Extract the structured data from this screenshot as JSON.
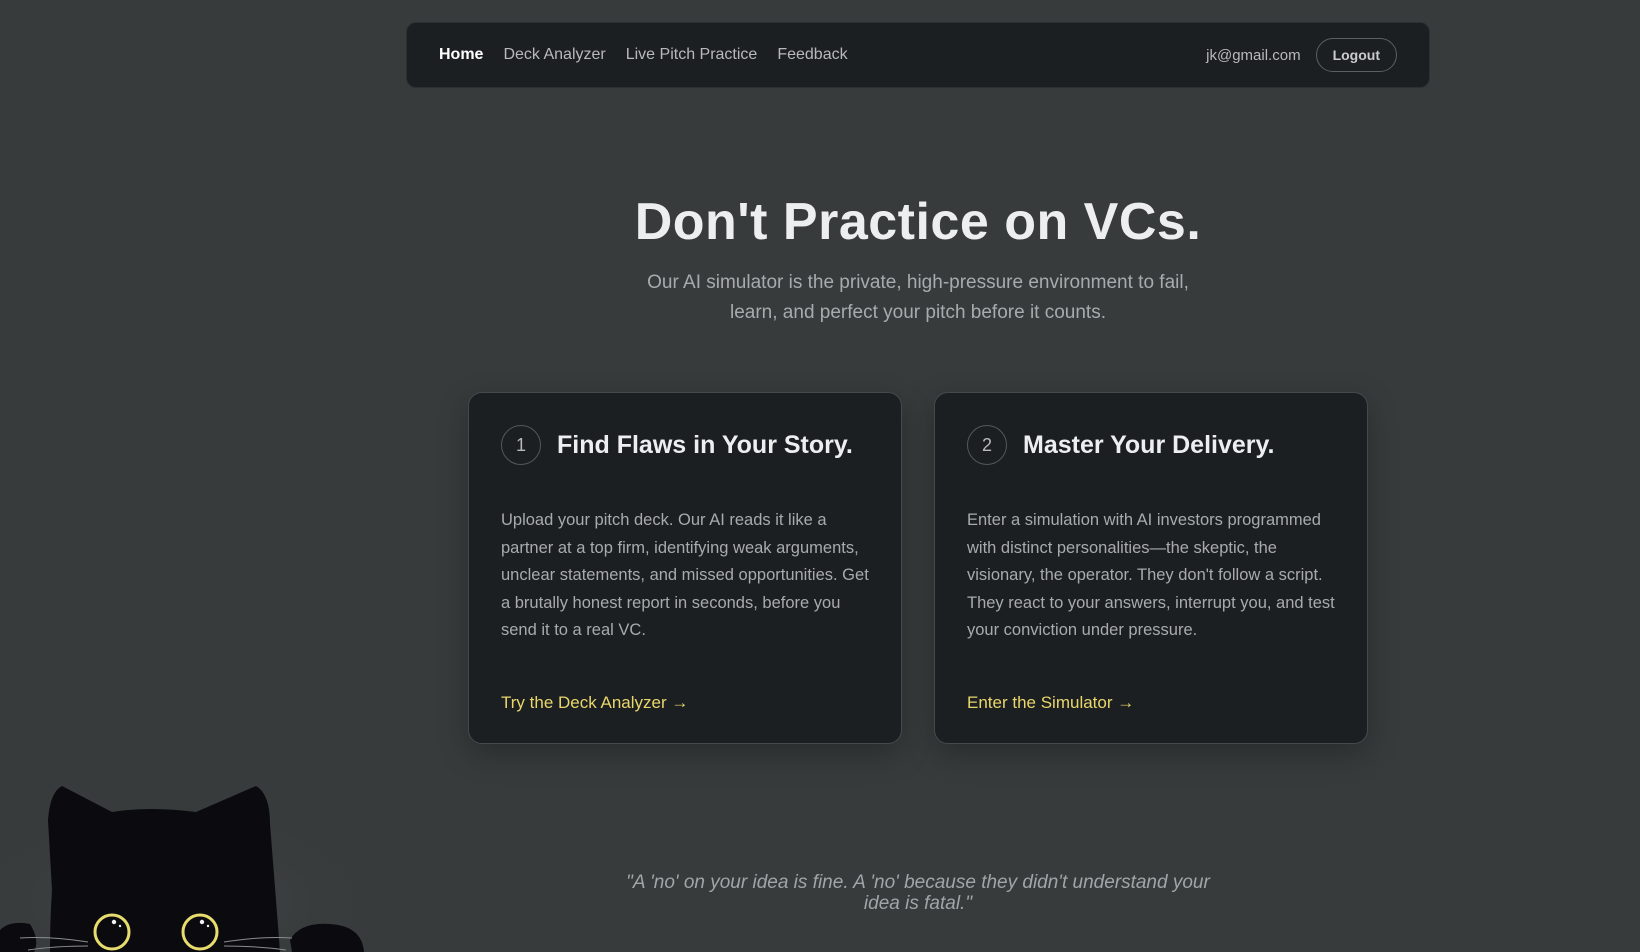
{
  "nav": {
    "links": [
      "Home",
      "Deck Analyzer",
      "Live Pitch Practice",
      "Feedback"
    ],
    "user_email": "jk@gmail.com",
    "logout_label": "Logout"
  },
  "hero": {
    "title": "Don't Practice on VCs.",
    "subtitle": "Our AI simulator is the private, high-pressure environment to fail, learn, and perfect your pitch before it counts."
  },
  "cards": [
    {
      "number": "1",
      "title": "Find Flaws in Your Story.",
      "body": "Upload your pitch deck. Our AI reads it like a partner at a top firm, identifying weak arguments, unclear statements, and missed opportunities. Get a brutally honest report in seconds, before you send it to a real VC.",
      "link": "Try the Deck Analyzer →"
    },
    {
      "number": "2",
      "title": "Master Your Delivery.",
      "body": "Enter a simulation with AI investors programmed with distinct personalities—the skeptic, the visionary, the operator. They don't follow a script. They react to your answers, interrupt you, and test your conviction under pressure.",
      "link": "Enter the Simulator →"
    }
  ],
  "quote": "\"A 'no' on your idea is fine. A 'no' because they didn't understand your idea is fatal.\"",
  "colors": {
    "background": "#373b3b",
    "card": "#1c1f21",
    "accent": "#e9d66b"
  },
  "icons": [
    "cat-mascot-icon"
  ]
}
